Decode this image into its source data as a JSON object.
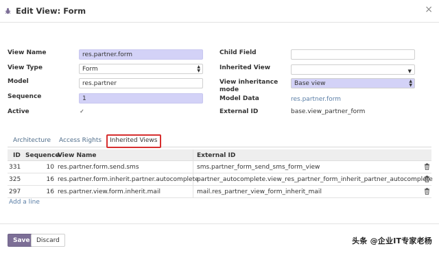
{
  "header": {
    "title": "Edit View: Form",
    "close_symbol": "×"
  },
  "form_left": {
    "view_name": {
      "label": "View Name",
      "value": "res.partner.form"
    },
    "view_type": {
      "label": "View Type",
      "value": "Form"
    },
    "model": {
      "label": "Model",
      "value": "res.partner"
    },
    "sequence": {
      "label": "Sequence",
      "value": "1"
    },
    "active": {
      "label": "Active",
      "checked": true,
      "check_symbol": "✓"
    }
  },
  "form_right": {
    "child_field": {
      "label": "Child Field",
      "value": ""
    },
    "inherited_view": {
      "label": "Inherited View",
      "value": ""
    },
    "view_inheritance_mode": {
      "label_line1": "View inheritance",
      "label_line2": "mode",
      "value": "Base view"
    },
    "model_data": {
      "label": "Model Data",
      "value": "res.partner.form"
    },
    "external_id": {
      "label": "External ID",
      "value": "base.view_partner_form"
    }
  },
  "tabs": [
    {
      "label": "Architecture",
      "active": false
    },
    {
      "label": "Access Rights",
      "active": false
    },
    {
      "label": "Inherited Views",
      "active": true
    }
  ],
  "table": {
    "columns": [
      "ID",
      "Sequence",
      "View Name",
      "External ID"
    ],
    "sort_symbol": "▲",
    "rows": [
      {
        "id": "331",
        "sequence": "10",
        "view_name": "res.partner.form.send.sms",
        "external_id": "sms.partner_form_send_sms_form_view"
      },
      {
        "id": "325",
        "sequence": "16",
        "view_name": "res.partner.form.inherit.partner.autocomplete",
        "external_id": "partner_autocomplete.view_res_partner_form_inherit_partner_autocomplete"
      },
      {
        "id": "297",
        "sequence": "16",
        "view_name": "res.partner.view.form.inherit.mail",
        "external_id": "mail.res_partner_view_form_inherit_mail"
      }
    ],
    "add_line": "Add a line"
  },
  "footer": {
    "save_label": "Save",
    "discard_label": "Discard"
  },
  "watermark": "头条 @企业IT专家老杨",
  "colors": {
    "accent": "#7c6e96",
    "required_field": "#d3d2f7",
    "link": "#5a7ea6",
    "highlight_border": "#d62e2e"
  },
  "icons": [
    "bug-icon",
    "close-icon",
    "select-arrows-icon",
    "caret-down-icon",
    "check-icon",
    "sort-icon",
    "trash-icon"
  ]
}
